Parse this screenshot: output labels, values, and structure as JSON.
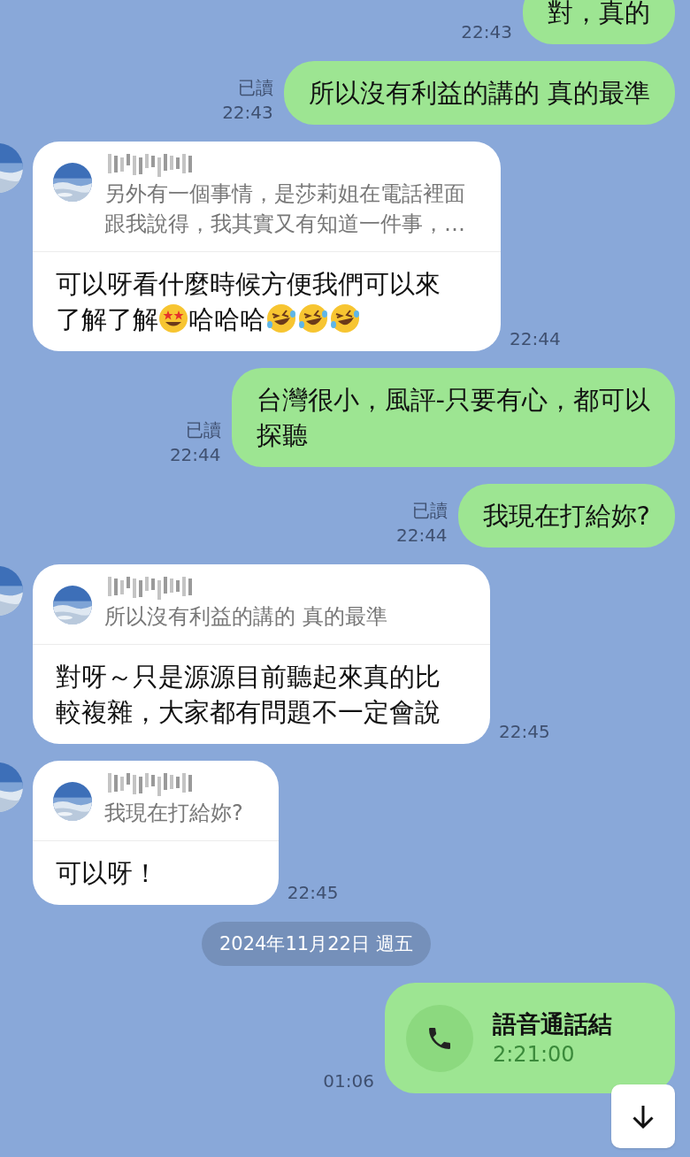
{
  "messages": [
    {
      "kind": "outgoing",
      "time": "22:43",
      "lines": [
        "對，真的"
      ]
    },
    {
      "kind": "outgoing",
      "read_label": "已讀",
      "time": "22:43",
      "lines": [
        "所以沒有利益的講的 真的最準"
      ]
    },
    {
      "kind": "reply",
      "time": "22:44",
      "quote": [
        "另外有一個事情，是莎莉姐在電話裡面",
        "跟我說得，我其實又有知道一件事，…"
      ],
      "lines": [
        "可以呀看什麼時候方便我們可以來",
        [
          {
            "kind": "text",
            "text": "了解了解"
          },
          {
            "kind": "star_eyes"
          },
          {
            "kind": "text",
            "text": "哈哈哈"
          },
          {
            "kind": "laughing"
          },
          {
            "kind": "laughing"
          },
          {
            "kind": "laughing"
          }
        ]
      ]
    },
    {
      "kind": "outgoing",
      "read_label": "已讀",
      "time": "22:44",
      "lines": [
        "台灣很小，風評-只要有心，都可以",
        "探聽"
      ]
    },
    {
      "kind": "outgoing",
      "read_label": "已讀",
      "time": "22:44",
      "lines": [
        "我現在打給妳?"
      ]
    },
    {
      "kind": "reply",
      "time": "22:45",
      "quote": [
        "所以沒有利益的講的 真的最準"
      ],
      "lines": [
        "對呀～只是源源目前聽起來真的比",
        "較複雜，大家都有問題不一定會說"
      ]
    },
    {
      "kind": "reply",
      "time": "22:45",
      "quote": [
        "我現在打給妳?"
      ],
      "lines": [
        "可以呀！"
      ]
    },
    {
      "kind": "date",
      "text": "2024年11月22日 週五"
    },
    {
      "kind": "call",
      "time": "01:06",
      "title": "語音通話結",
      "duration": "2:21:00"
    }
  ]
}
